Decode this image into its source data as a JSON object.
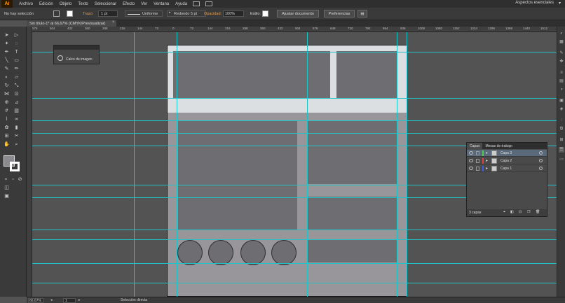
{
  "menubar": {
    "logo": "Ai",
    "items": [
      "Archivo",
      "Edición",
      "Objeto",
      "Texto",
      "Seleccionar",
      "Efecto",
      "Ver",
      "Ventana",
      "Ayuda"
    ],
    "workspace": "Aspectos esenciales",
    "workspace_caret": "▾"
  },
  "controlbar": {
    "selection_status": "No hay selección",
    "stroke_label": "Trazo:",
    "stroke_weight": "1 pt",
    "stroke_profile": "Uniforme",
    "brush": "Redondo 5 pt",
    "opacity_label": "Opacidad:",
    "opacity_value": "100%",
    "style_label": "Estilo:",
    "doc_setup_button": "Ajustar documento",
    "preferences_button": "Preferencias"
  },
  "document": {
    "tab_title": "Sin título-1* al 66,67% (CMYK/Previsualizar)",
    "close": "×"
  },
  "ruler": {
    "h_ticks": [
      "576",
      "504",
      "432",
      "360",
      "288",
      "216",
      "144",
      "72",
      "0",
      "72",
      "144",
      "216",
      "288",
      "360",
      "432",
      "504",
      "576",
      "648",
      "720",
      "792",
      "864",
      "936",
      "1008",
      "1080",
      "1152",
      "1224",
      "1296",
      "1368",
      "1440",
      "1512"
    ]
  },
  "trace_panel": {
    "label": "Calco de imagen"
  },
  "layers_panel": {
    "tab_layers": "Capas",
    "tab_artboards": "Mesas de trabajo",
    "layers": [
      {
        "name": "Capa 3",
        "color": "#4ad04a",
        "selected": true
      },
      {
        "name": "Capa 2",
        "color": "#e04040",
        "selected": false
      },
      {
        "name": "Capa 1",
        "color": "#4060e0",
        "selected": false
      }
    ],
    "count": "3 capas"
  },
  "statusbar": {
    "zoom": "66,67%",
    "page": "1",
    "tool": "Selección directa"
  },
  "colors": {
    "guide": "#1fc4c9",
    "artboard": "#98969a",
    "block": "#6e6d72",
    "band": "#dcdfe2"
  }
}
